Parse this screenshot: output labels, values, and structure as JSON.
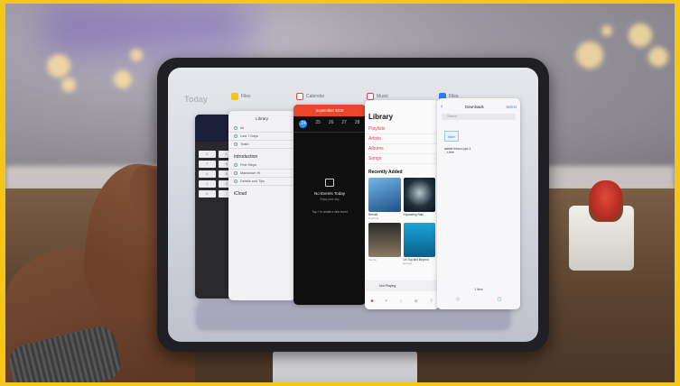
{
  "app_labels": {
    "files": "Files",
    "calendar": "Calendar",
    "music": "Music",
    "files2": "Files"
  },
  "background_app": {
    "title": "Today"
  },
  "calculator": {
    "keys": [
      "C",
      "±",
      "7",
      "8",
      "4",
      "5",
      "1",
      "2",
      "0",
      "."
    ]
  },
  "files_card": {
    "header": "Library",
    "rows": [
      "All",
      "Last 7 Days",
      "Trash"
    ],
    "section1": "Introduction",
    "section1_rows": [
      "First Steps",
      "Markdown Hi",
      "Details and Tips"
    ],
    "section2": "iCloud"
  },
  "calendar_card": {
    "month": "September 2018",
    "days": [
      "24",
      "25",
      "26",
      "27",
      "28"
    ],
    "today_index": 0,
    "no_events": "No Events Today",
    "sub": "Enjoy your day",
    "tap": "Tap + to create a new event"
  },
  "music_card": {
    "title": "Library",
    "links": [
      "Playlists",
      "Artists",
      "Albums",
      "Songs"
    ],
    "recent": "Recently Added",
    "albums": [
      {
        "name": "Nebula",
        "artist": "Daphnia",
        "color": "#3c7ab8"
      },
      {
        "name": "Expanding Rain",
        "artist": "",
        "color": "#1a2a3a"
      },
      {
        "name": "",
        "artist": "Iberian",
        "color": "#6b5a44"
      },
      {
        "name": "On Top and Beyond",
        "artist": "Europa",
        "color": "#0d7fb0"
      }
    ],
    "now_playing": "Not Playing"
  },
  "downloads_card": {
    "title": "Downloads",
    "select": "Select",
    "search": "Search",
    "file_icon_label": "folder",
    "file_name": "adobe fresco (opt-1 ...r-free",
    "items": "1 item"
  },
  "colors": {
    "frame": "#f5c518",
    "accent_red": "#e9462c",
    "music_pink": "#e2405c",
    "link_blue": "#2b7bff"
  }
}
